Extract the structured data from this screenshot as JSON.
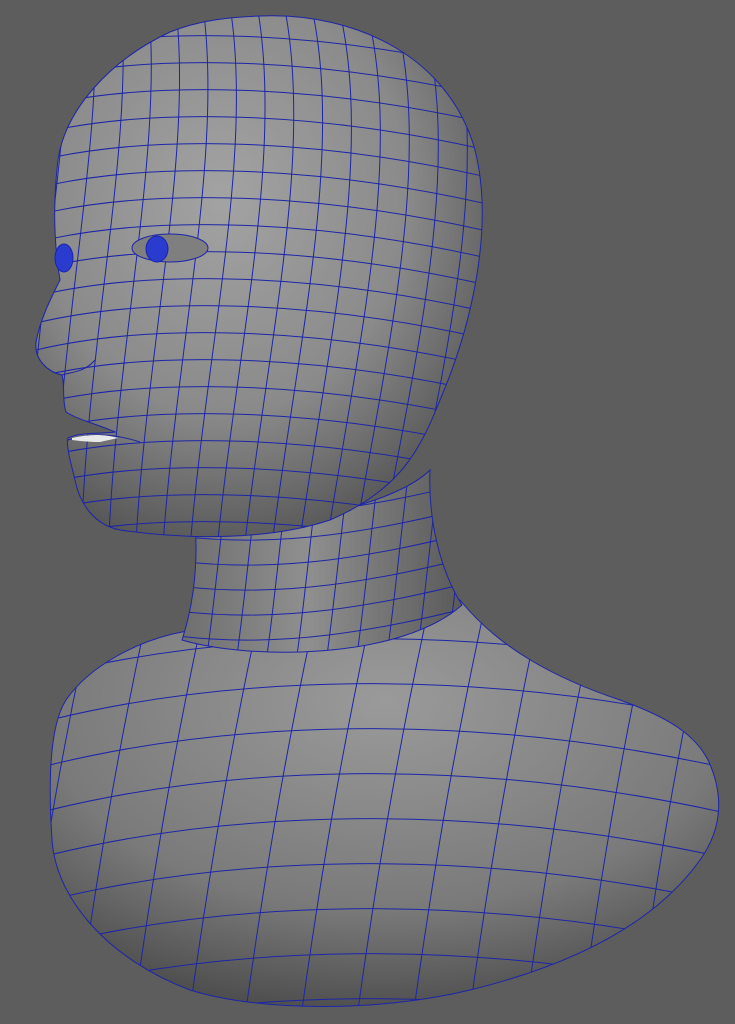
{
  "viewport": {
    "background_color": "#5d5d5d",
    "shading": "smooth-shaded-with-wireframe",
    "model": "human-head-bust",
    "wireframe_color": "#1c25a8",
    "eye_color": "#2a3bd0",
    "surface_highlight": "#a9a9a9",
    "surface_shadow": "#3c3c3c"
  }
}
